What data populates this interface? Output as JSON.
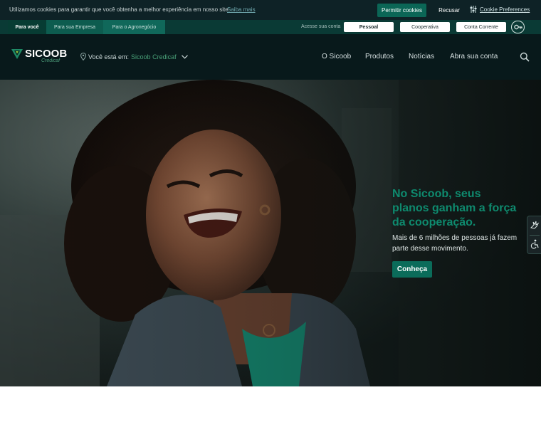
{
  "cookie_bar": {
    "text": "Utilizamos cookies para garantir que você obtenha a melhor experiência em nosso site.",
    "learn_more": "Saiba mais",
    "allow_label": "Permitir cookies",
    "refuse_label": "Recusar",
    "preferences_label": "Cookie Preferences"
  },
  "segments": {
    "tabs": [
      {
        "label": "Para você"
      },
      {
        "label": "Para sua Empresa"
      },
      {
        "label": "Para o Agronegócio"
      }
    ],
    "access_label": "Acesse sua conta",
    "access_buttons": [
      {
        "label": "Pessoal"
      },
      {
        "label": "Cooperativa"
      },
      {
        "label": "Conta Corrente"
      }
    ],
    "key_icon": "key-icon"
  },
  "header": {
    "logo_text": "SICOOB",
    "logo_sub": "Credicaf",
    "location_label": "Você está em:",
    "location_value": "Sicoob Credicaf",
    "nav": [
      {
        "label": "O Sicoob"
      },
      {
        "label": "Produtos"
      },
      {
        "label": "Notícias"
      },
      {
        "label": "Abra sua conta"
      }
    ],
    "search_icon": "search-icon"
  },
  "hero": {
    "title": "No Sicoob, seus planos ganham a força da cooperação.",
    "subtitle": "Mais de 6 milhões de pessoas já fazem parte desse movimento.",
    "cta_label": "Conheça"
  },
  "side_widget": {
    "icons": [
      "sign-language-icon",
      "accessibility-icon"
    ]
  },
  "colors": {
    "brand_green": "#0b6c5a",
    "brand_light_green": "#49a078",
    "dark_bg": "#08191b"
  }
}
